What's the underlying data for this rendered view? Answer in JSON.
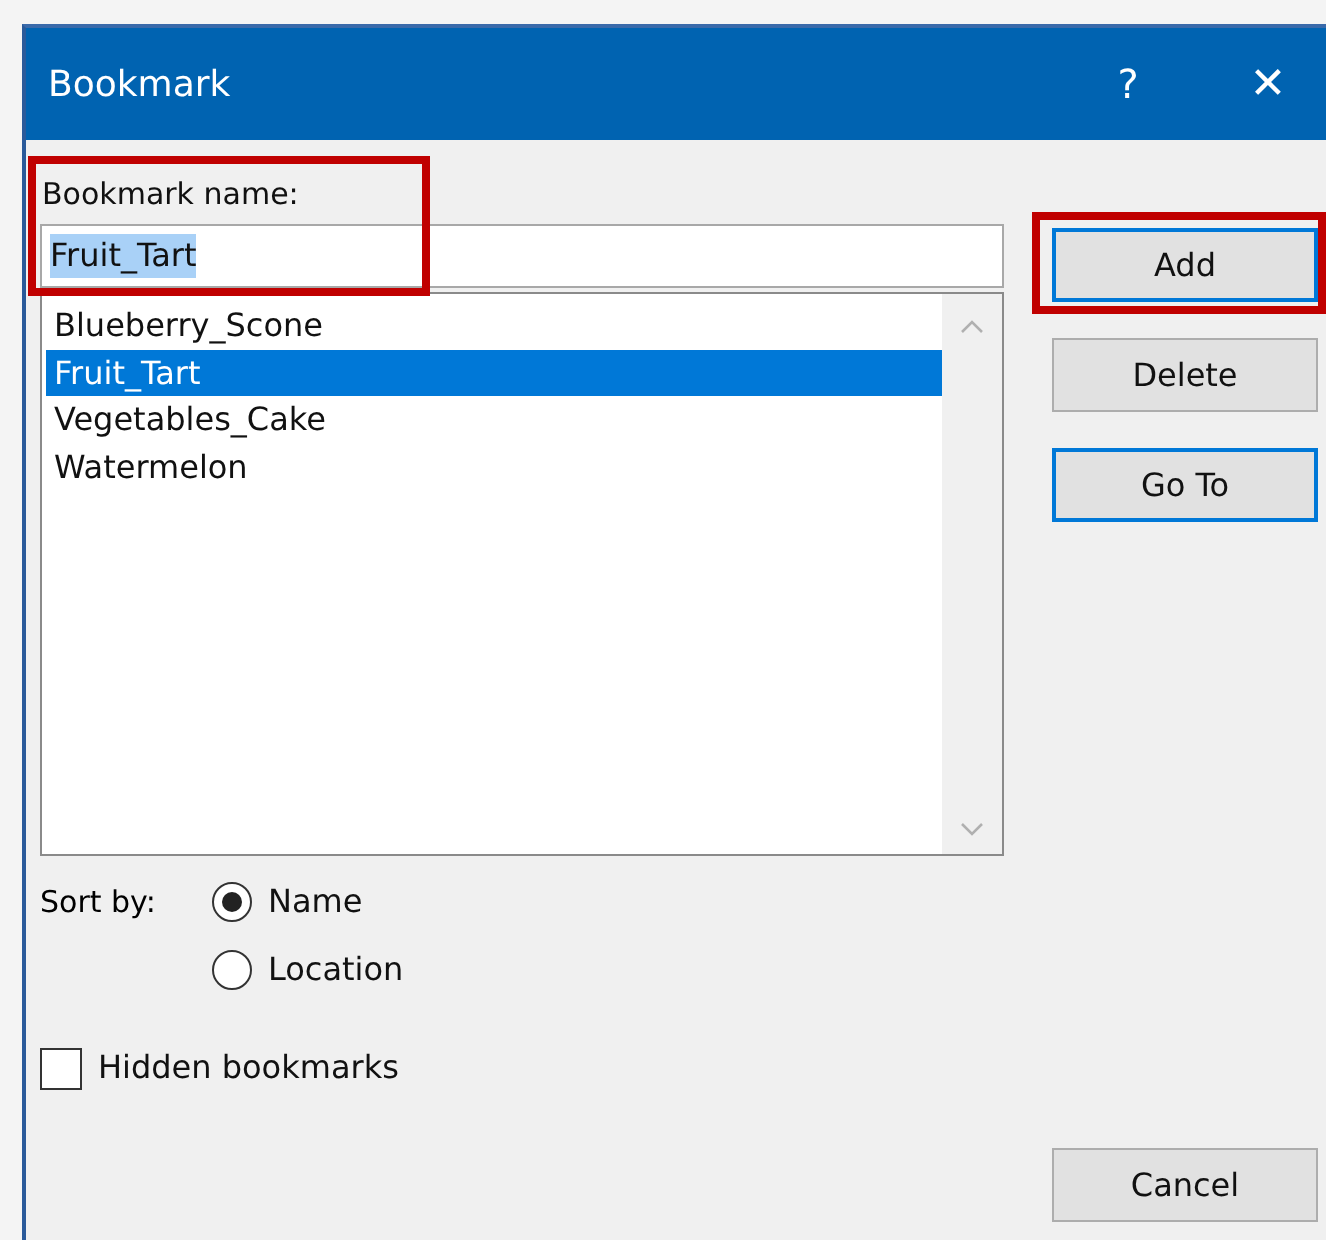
{
  "window": {
    "title": "Bookmark",
    "help": "?",
    "close": "✕"
  },
  "name_field": {
    "label": "Bookmark name:",
    "value": "Fruit_Tart",
    "highlighted": true
  },
  "bookmarks": [
    {
      "label": "Blueberry_Scone",
      "selected": false
    },
    {
      "label": "Fruit_Tart",
      "selected": true
    },
    {
      "label": "Vegetables_Cake",
      "selected": false
    },
    {
      "label": "Watermelon",
      "selected": false
    }
  ],
  "buttons": [
    {
      "label": "Add",
      "focused": true,
      "highlighted": true
    },
    {
      "label": "Delete",
      "focused": false,
      "highlighted": false
    },
    {
      "label": "Go To",
      "focused": true,
      "highlighted": false
    }
  ],
  "sort_by": {
    "label": "Sort by:",
    "options": [
      {
        "label": "Name",
        "selected": true
      },
      {
        "label": "Location",
        "selected": false
      }
    ]
  },
  "hidden_bookmarks": {
    "label": "Hidden bookmarks",
    "checked": false
  },
  "cancel": {
    "label": "Cancel"
  }
}
